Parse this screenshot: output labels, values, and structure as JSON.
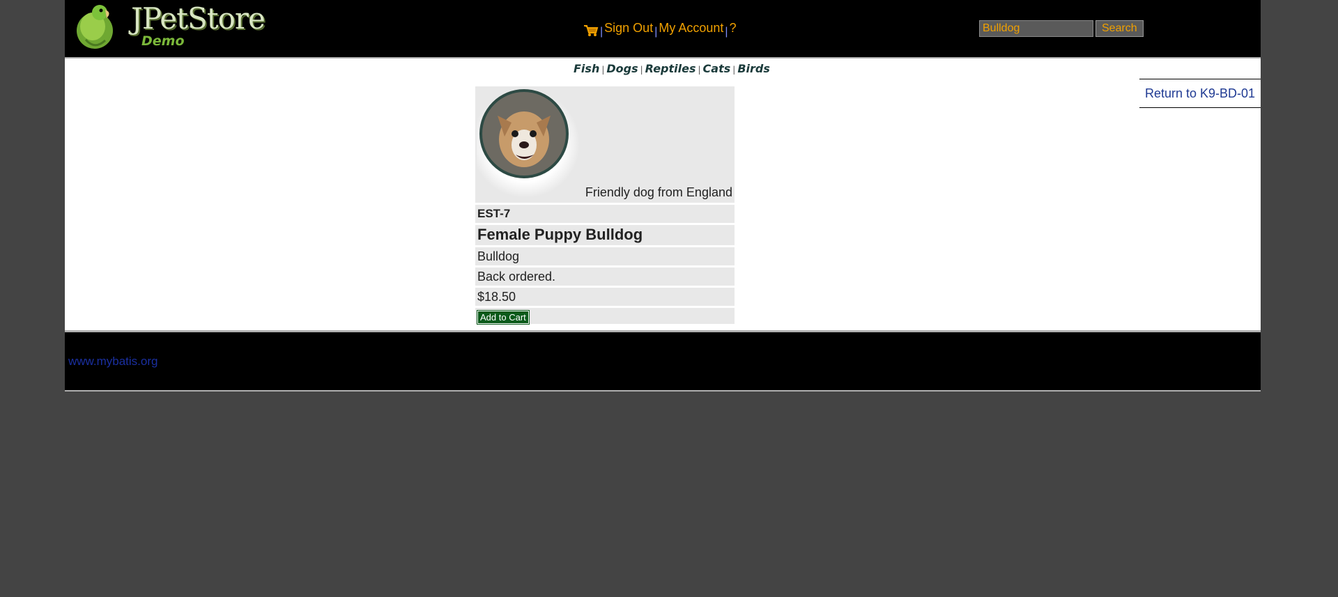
{
  "header": {
    "logo_title": "JPetStore",
    "logo_subtitle": "Demo",
    "menu": {
      "sign_out": "Sign Out",
      "my_account": "My Account",
      "help": "?",
      "separator": "|"
    },
    "search": {
      "value": "Bulldog",
      "button_label": "Search"
    }
  },
  "quicklinks": [
    "Fish",
    "Dogs",
    "Reptiles",
    "Cats",
    "Birds"
  ],
  "back_link": "Return to K9-BD-01",
  "item": {
    "description": "Friendly dog from England",
    "id": "EST-7",
    "name": "Female Puppy Bulldog",
    "attribute": "Bulldog",
    "stock": "Back ordered.",
    "price": "$18.50",
    "add_to_cart": "Add to Cart"
  },
  "footer": {
    "link": "www.mybatis.org"
  },
  "colors": {
    "accent": "#f0a000",
    "link": "#1f3a93",
    "button_green": "#0a5a1a"
  }
}
